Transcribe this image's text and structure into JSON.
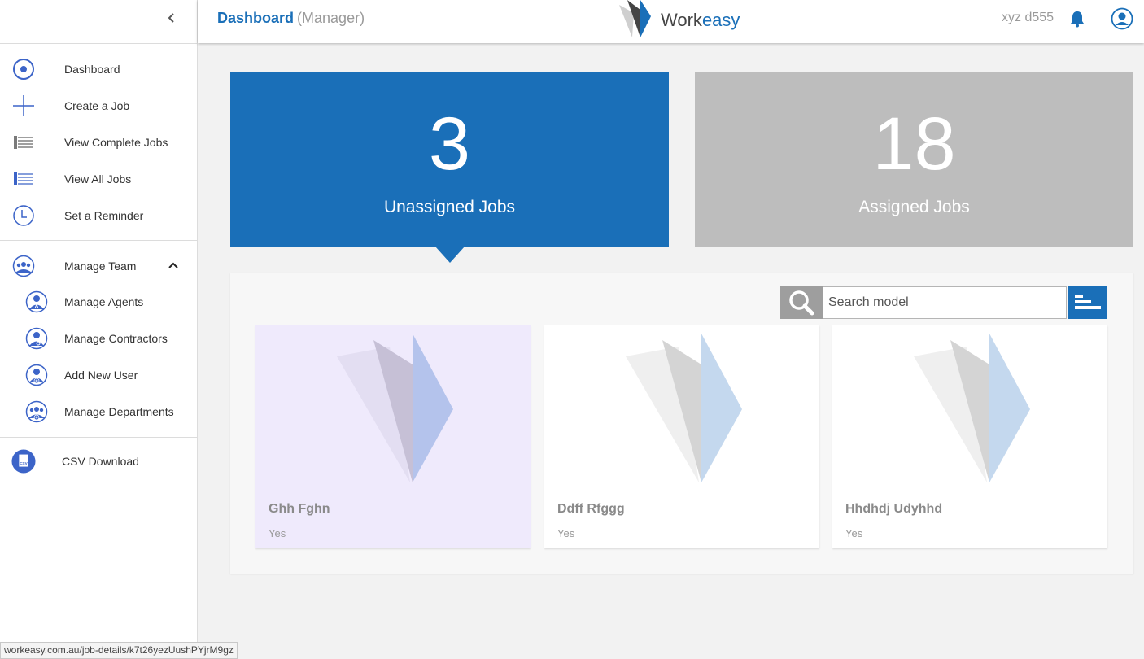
{
  "sidebar": {
    "items": [
      {
        "label": "Dashboard"
      },
      {
        "label": "Create a Job"
      },
      {
        "label": "View Complete Jobs"
      },
      {
        "label": "View All Jobs"
      },
      {
        "label": "Set a Reminder"
      },
      {
        "label": "Manage Team"
      },
      {
        "label": "Manage Agents"
      },
      {
        "label": "Manage Contractors"
      },
      {
        "label": "Add New User"
      },
      {
        "label": "Manage Departments"
      },
      {
        "label": "CSV Download"
      }
    ],
    "csv_icon_text": "CSV"
  },
  "header": {
    "title": "Dashboard",
    "role": "(Manager)",
    "logo_text_1": "Work",
    "logo_text_2": "easy",
    "user_name": "xyz d555"
  },
  "stats": {
    "unassigned": {
      "count": "3",
      "label": "Unassigned Jobs"
    },
    "assigned": {
      "count": "18",
      "label": "Assigned Jobs"
    }
  },
  "search": {
    "placeholder": "Search model",
    "value": ""
  },
  "jobs": [
    {
      "name": "Ghh Fghn",
      "status": "Yes"
    },
    {
      "name": "Ddff Rfggg",
      "status": "Yes"
    },
    {
      "name": "Hhdhdj Udyhhd",
      "status": "Yes"
    }
  ],
  "status_bar": {
    "url": "workeasy.com.au/job-details/k7t26yezUushPYjrM9gz"
  },
  "colors": {
    "accent": "#1a6fb8",
    "inactive": "#bdbdbd",
    "selected_card": "#efeafc",
    "icon": "#3c64c8"
  }
}
